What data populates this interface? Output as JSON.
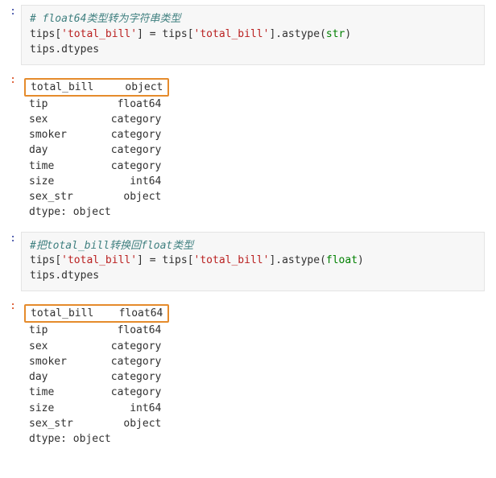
{
  "cell1": {
    "prompt": ":",
    "comment": "# float64类型转为字符串类型",
    "code_line": {
      "lhs_var": "tips",
      "lhs_key": "'total_bill'",
      "rhs_var": "tips",
      "rhs_key": "'total_bill'",
      "method": "astype",
      "arg": "str"
    },
    "dtypes_call": "tips",
    "dtypes_attr": "dtypes"
  },
  "out1": {
    "prompt": ":",
    "highlight": {
      "name": "total_bill",
      "dtype": "object"
    },
    "rows": [
      {
        "name": "tip",
        "dtype": "float64"
      },
      {
        "name": "sex",
        "dtype": "category"
      },
      {
        "name": "smoker",
        "dtype": "category"
      },
      {
        "name": "day",
        "dtype": "category"
      },
      {
        "name": "time",
        "dtype": "category"
      },
      {
        "name": "size",
        "dtype": "int64"
      },
      {
        "name": "sex_str",
        "dtype": "object"
      }
    ],
    "footer": "dtype: object"
  },
  "cell2": {
    "prompt": ":",
    "comment": "#把total_bill转换回float类型",
    "code_line": {
      "lhs_var": "tips",
      "lhs_key": "'total_bill'",
      "rhs_var": "tips",
      "rhs_key": "'total_bill'",
      "method": "astype",
      "arg": "float"
    },
    "dtypes_call": "tips",
    "dtypes_attr": "dtypes"
  },
  "out2": {
    "prompt": ":",
    "highlight": {
      "name": "total_bill",
      "dtype": "float64"
    },
    "rows": [
      {
        "name": "tip",
        "dtype": "float64"
      },
      {
        "name": "sex",
        "dtype": "category"
      },
      {
        "name": "smoker",
        "dtype": "category"
      },
      {
        "name": "day",
        "dtype": "category"
      },
      {
        "name": "time",
        "dtype": "category"
      },
      {
        "name": "size",
        "dtype": "int64"
      },
      {
        "name": "sex_str",
        "dtype": "object"
      }
    ],
    "footer": "dtype: object"
  }
}
